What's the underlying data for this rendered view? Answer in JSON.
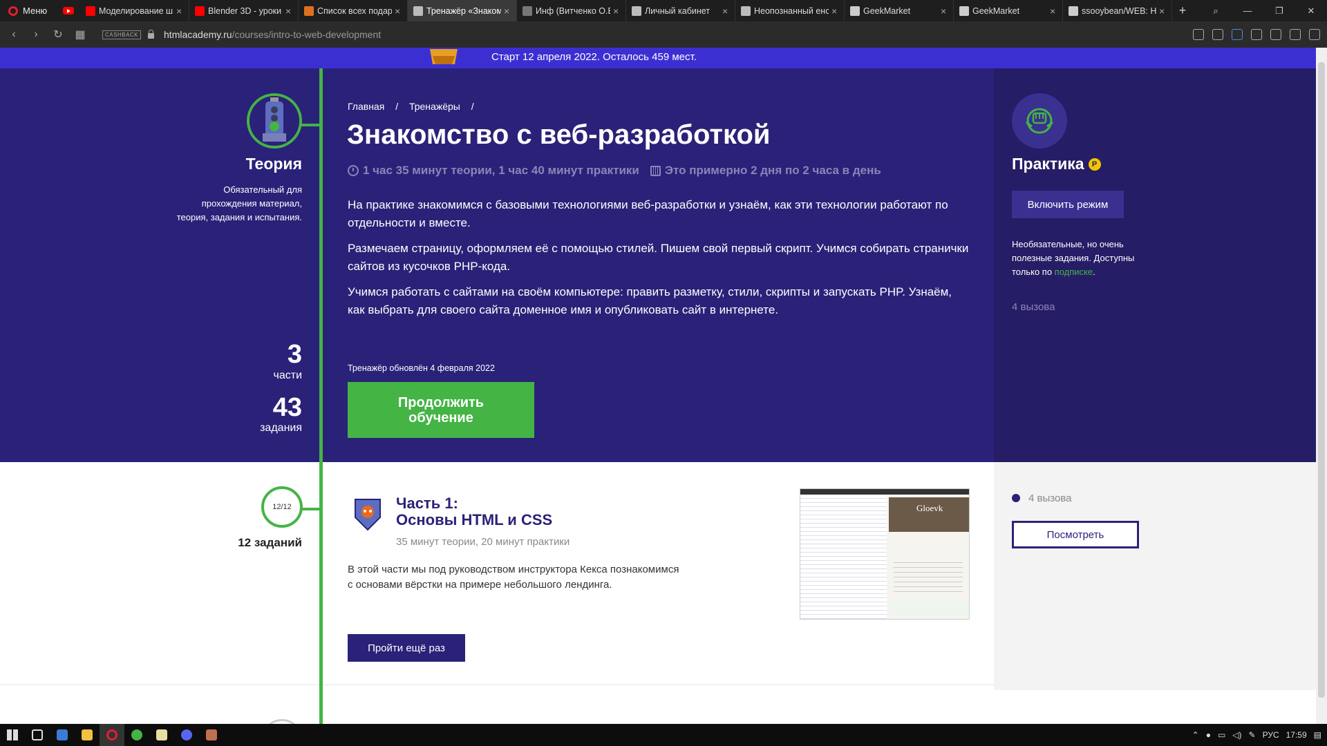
{
  "browser": {
    "menu_label": "Меню",
    "tabs": [
      {
        "label": "Моделирование ш",
        "color": "#ff0000"
      },
      {
        "label": "Blender 3D - уроки",
        "color": "#ff0000"
      },
      {
        "label": "Список всех подар",
        "color": "#e07020"
      },
      {
        "label": "Тренажёр «Знаком",
        "color": "#bbbbbb",
        "active": true
      },
      {
        "label": "Инф (Витченко О.В",
        "color": "#777777"
      },
      {
        "label": "Личный кабинет",
        "color": "#bbbbbb"
      },
      {
        "label": "Неопознанный енс",
        "color": "#bbbbbb"
      },
      {
        "label": "GeekMarket",
        "color": "#cccccc"
      },
      {
        "label": "GeekMarket",
        "color": "#cccccc"
      },
      {
        "label": "ssooybean/WEB: H",
        "color": "#cccccc"
      }
    ],
    "cashback_label": "CASHBACK",
    "url_host": "htmlacademy.ru",
    "url_path": "/courses/intro-to-web-development"
  },
  "promo": {
    "text": "Старт 12 апреля 2022. Осталось 459 мест."
  },
  "theory": {
    "title": "Теория",
    "description": "Обязательный для прохождения материал, теория, задания и испытания.",
    "parts_count": "3",
    "parts_label": "части",
    "tasks_count": "43",
    "tasks_label": "задания"
  },
  "course": {
    "breadcrumbs": [
      "Главная",
      "/",
      "Тренажёры",
      "/"
    ],
    "title": "Знакомство с веб-разработкой",
    "duration": "1 час 35 минут теории, 1 час 40 минут практики",
    "pace": "Это примерно 2 дня по 2 часа в день",
    "paragraphs": [
      "На практике знакомимся с базовыми технологиями веб-разработки и узнаём, как эти технологии работают по отдельности и вместе.",
      "Размечаем страницу, оформляем её с помощью стилей. Пишем свой первый скрипт. Учимся собирать странички сайтов из кусочков PHP-кода.",
      "Учимся работать с сайтами на своём компьютере: править разметку, стили, скрипты и запускать PHP. Узнаём, как выбрать для своего сайта доменное имя и опубликовать сайт в интернете."
    ],
    "updated": "Тренажёр обновлён 4 февраля 2022",
    "continue_label": "Продолжить обучение"
  },
  "practice": {
    "title": "Практика",
    "coin": "Р",
    "mode_button": "Включить режим",
    "desc_main": "Необязательные, но очень полезные задания. Доступны только по ",
    "desc_link": "подписке",
    "desc_end": ".",
    "challenges": "4 вызова"
  },
  "part1": {
    "progress": "12/12",
    "tasks": "12 заданий",
    "title_line1": "Часть 1:",
    "title_line2": "Основы HTML и CSS",
    "time": "35 минут теории, 20 минут практики",
    "description": "В этой части мы под руководством инструктора Кекса познакомимся с основами вёрстки на примере небольшого лендинга.",
    "retry_label": "Пройти ещё раз",
    "challenges": "4 вызова",
    "view_label": "Посмотреть",
    "thumb_title": "Gloevk"
  },
  "taskbar": {
    "lang": "РУС",
    "time": "17:59"
  }
}
